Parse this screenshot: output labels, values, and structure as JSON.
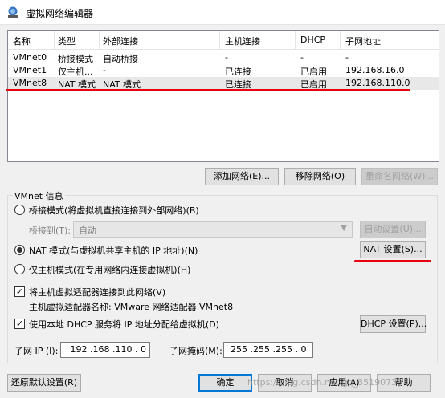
{
  "window": {
    "title": "虚拟网络编辑器",
    "icon": "vmware-network-icon"
  },
  "network_list": {
    "columns": [
      "名称",
      "类型",
      "外部连接",
      "主机连接",
      "DHCP",
      "子网地址"
    ],
    "rows": [
      {
        "name": "VMnet0",
        "type": "桥接模式",
        "external": "自动桥接",
        "host": "-",
        "dhcp": "-",
        "subnet": "-"
      },
      {
        "name": "VMnet1",
        "type": "仅主机...",
        "external": "-",
        "host": "已连接",
        "dhcp": "已启用",
        "subnet": "192.168.16.0"
      },
      {
        "name": "VMnet8",
        "type": "NAT 模式",
        "external": "NAT 模式",
        "host": "已连接",
        "dhcp": "已启用",
        "subnet": "192.168.110.0"
      }
    ],
    "selected_row": "VMnet8"
  },
  "list_buttons": {
    "add": "添加网络(E)...",
    "remove": "移除网络(O)",
    "rename": "重命名网络(W)..."
  },
  "vmnet_info": {
    "group_title": "VMnet 信息",
    "bridge_radio": "桥接模式(将虚拟机直接连接到外部网络)(B)",
    "bridge_to_label": "桥接到(T):",
    "bridge_to_value": "自动",
    "auto_settings": "自动设置(U)...",
    "nat_radio": "NAT 模式(与虚拟机共享主机的 IP 地址)(N)",
    "nat_settings": "NAT 设置(S)...",
    "host_only_radio": "仅主机模式(在专用网络内连接虚拟机)(H)",
    "connect_adapter": "将主机虚拟适配器连接到此网络(V)",
    "adapter_name": "主机虚拟适配器名称: VMware 网络适配器 VMnet8",
    "use_dhcp": "使用本地 DHCP 服务将 IP 地址分配给虚拟机(D)",
    "dhcp_settings": "DHCP 设置(P)...",
    "subnet_ip_label": "子网 IP (I):",
    "subnet_ip_value": " 192 .168 .110 . 0",
    "subnet_mask_label": "子网掩码(M):",
    "subnet_mask_value": "255 .255 .255 . 0",
    "selected_mode": "nat",
    "connect_adapter_checked": true,
    "use_dhcp_checked": true
  },
  "footer_buttons": {
    "restore_defaults": "还原默认设置(R)",
    "ok": "确定",
    "cancel": "取消",
    "apply": "应用(A)",
    "help": "帮助"
  },
  "watermark": "https://blog.csdn.net/qq_35190730",
  "colors": {
    "annotation_red": "#e60012",
    "selected_row": "#e8e8e8",
    "default_button_border": "#0078d7"
  }
}
